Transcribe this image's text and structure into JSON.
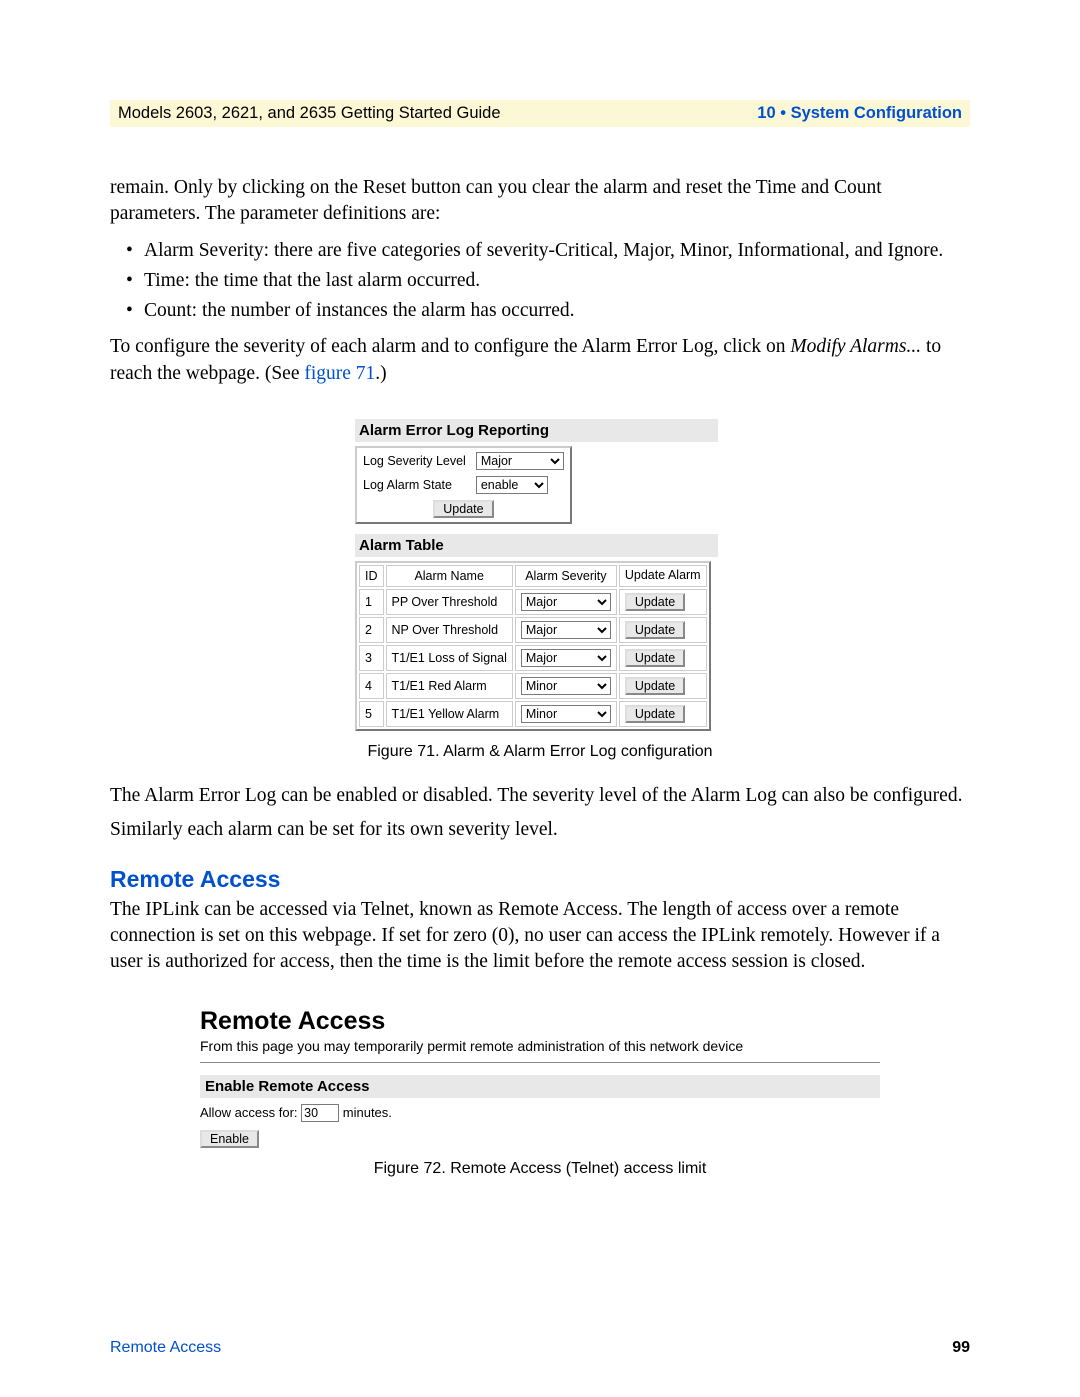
{
  "header": {
    "left": "Models 2603, 2621, and 2635 Getting Started Guide",
    "right": "10 • System Configuration"
  },
  "para1": "remain. Only by clicking on the Reset button can you clear the alarm and reset the Time and Count parameters. The parameter definitions are:",
  "bullets": [
    "Alarm Severity: there are five categories of severity-Critical, Major, Minor, Informational, and Ignore.",
    "Time: the time that the last alarm occurred.",
    "Count: the number of instances the alarm has occurred."
  ],
  "para2_a": "To configure the severity of each alarm and to configure the Alarm Error Log, click on ",
  "para2_em": "Modify Alarms...",
  "para2_b": " to reach the webpage. (See ",
  "para2_link": "figure 71",
  "para2_c": ".)",
  "fig71": {
    "heading1": "Alarm Error Log Reporting",
    "row1_label": "Log Severity Level",
    "row1_value": "Major",
    "row2_label": "Log Alarm State",
    "row2_value": "enable",
    "update_btn": "Update",
    "heading2": "Alarm Table",
    "cols": [
      "ID",
      "Alarm Name",
      "Alarm Severity",
      "Update Alarm"
    ],
    "rows": [
      {
        "id": "1",
        "name": "PP Over Threshold",
        "sev": "Major"
      },
      {
        "id": "2",
        "name": "NP Over Threshold",
        "sev": "Major"
      },
      {
        "id": "3",
        "name": "T1/E1 Loss of Signal",
        "sev": "Major"
      },
      {
        "id": "4",
        "name": "T1/E1 Red Alarm",
        "sev": "Minor"
      },
      {
        "id": "5",
        "name": "T1/E1 Yellow Alarm",
        "sev": "Minor"
      }
    ],
    "caption": "Figure 71. Alarm & Alarm Error Log configuration"
  },
  "para3": "The Alarm Error Log can be enabled or disabled. The severity level of the Alarm Log can also be configured.",
  "para4": "Similarly each alarm can be set for its own severity level.",
  "remote": {
    "heading": "Remote Access",
    "para": "The IPLink can be accessed via Telnet, known as Remote Access. The length of access over a remote connection is set on this webpage. If set for zero (0), no user can access the IPLink remotely. However if a user is authorized for access, then the time is the limit before the remote access session is closed."
  },
  "fig72": {
    "title": "Remote Access",
    "sub": "From this page you may temporarily permit remote administration of this network device",
    "enable_heading": "Enable Remote Access",
    "allow_a": "Allow access for: ",
    "allow_value": "30",
    "allow_b": " minutes.",
    "enable_btn": "Enable",
    "caption": "Figure 72. Remote Access (Telnet) access limit"
  },
  "footer": {
    "left": "Remote Access",
    "right": "99"
  }
}
